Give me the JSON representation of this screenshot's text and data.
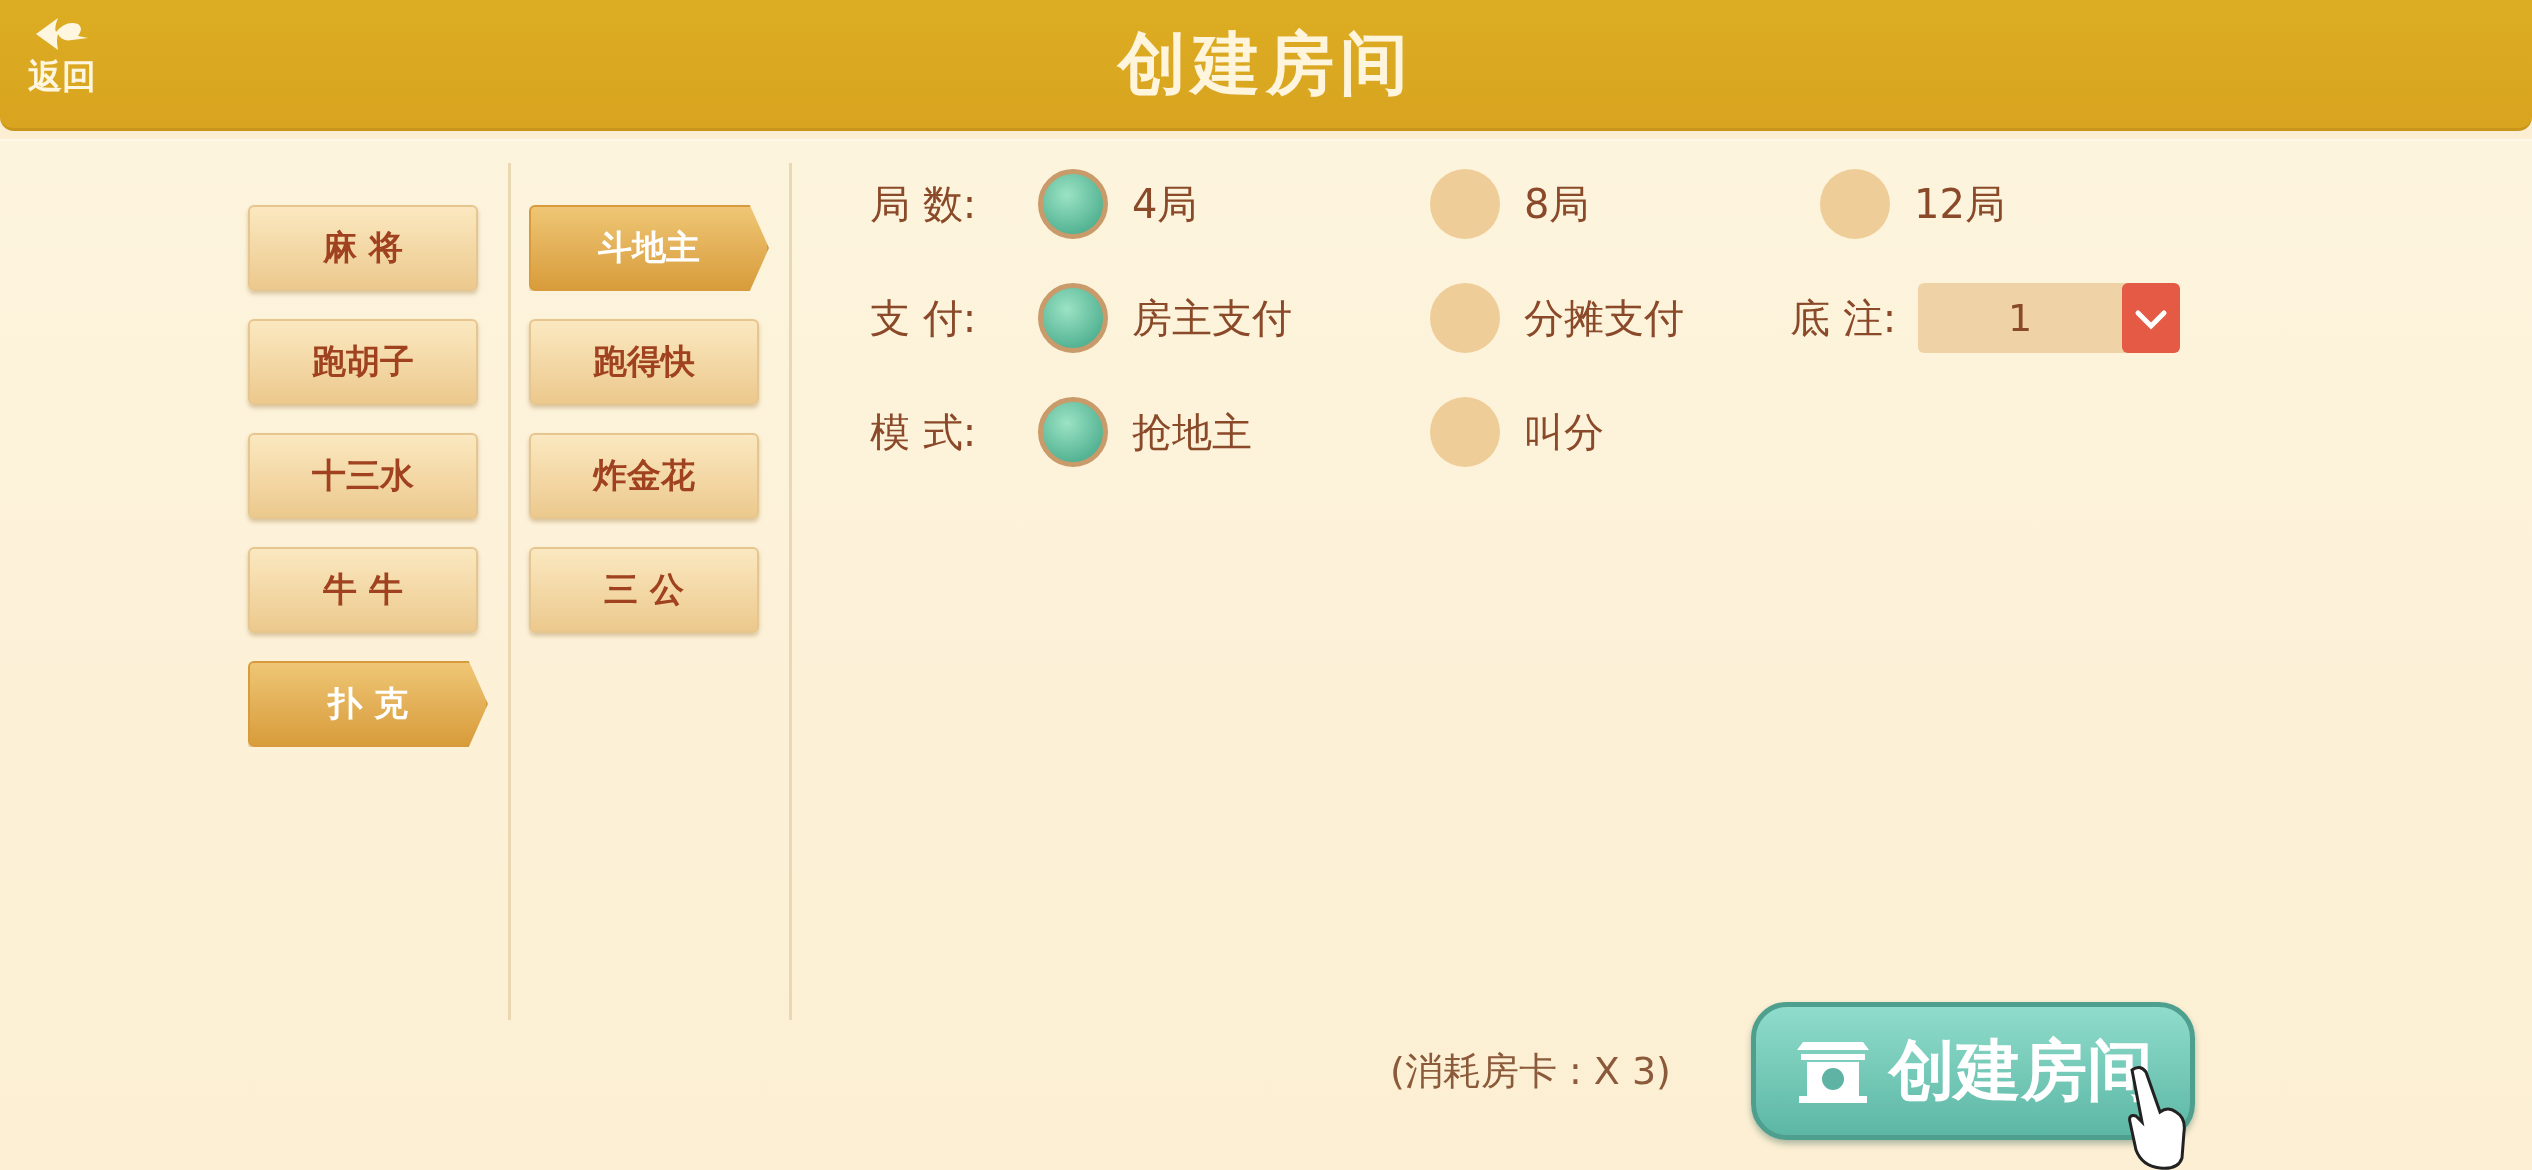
{
  "header": {
    "back_label": "返回",
    "title": "创建房间"
  },
  "categories": [
    {
      "label": "麻 将",
      "selected": false
    },
    {
      "label": "跑胡子",
      "selected": false
    },
    {
      "label": "十三水",
      "selected": false
    },
    {
      "label": "牛 牛",
      "selected": false
    },
    {
      "label": "扑 克",
      "selected": true
    }
  ],
  "games": [
    {
      "label": "斗地主",
      "selected": true
    },
    {
      "label": "跑得快",
      "selected": false
    },
    {
      "label": "炸金花",
      "selected": false
    },
    {
      "label": "三 公",
      "selected": false
    }
  ],
  "options": [
    {
      "label": "局 数:",
      "choices": [
        {
          "label": "4局",
          "selected": true
        },
        {
          "label": "8局",
          "selected": false
        },
        {
          "label": "12局",
          "selected": false
        }
      ]
    },
    {
      "label": "支 付:",
      "choices": [
        {
          "label": "房主支付",
          "selected": true
        },
        {
          "label": "分摊支付",
          "selected": false
        }
      ],
      "dropdown": {
        "label": "底 注:",
        "value": "1"
      }
    },
    {
      "label": "模 式:",
      "choices": [
        {
          "label": "抢地主",
          "selected": true
        },
        {
          "label": "叫分",
          "selected": false
        }
      ]
    }
  ],
  "cost": "(消耗房卡 : X 3)",
  "create_button": "创建房间"
}
